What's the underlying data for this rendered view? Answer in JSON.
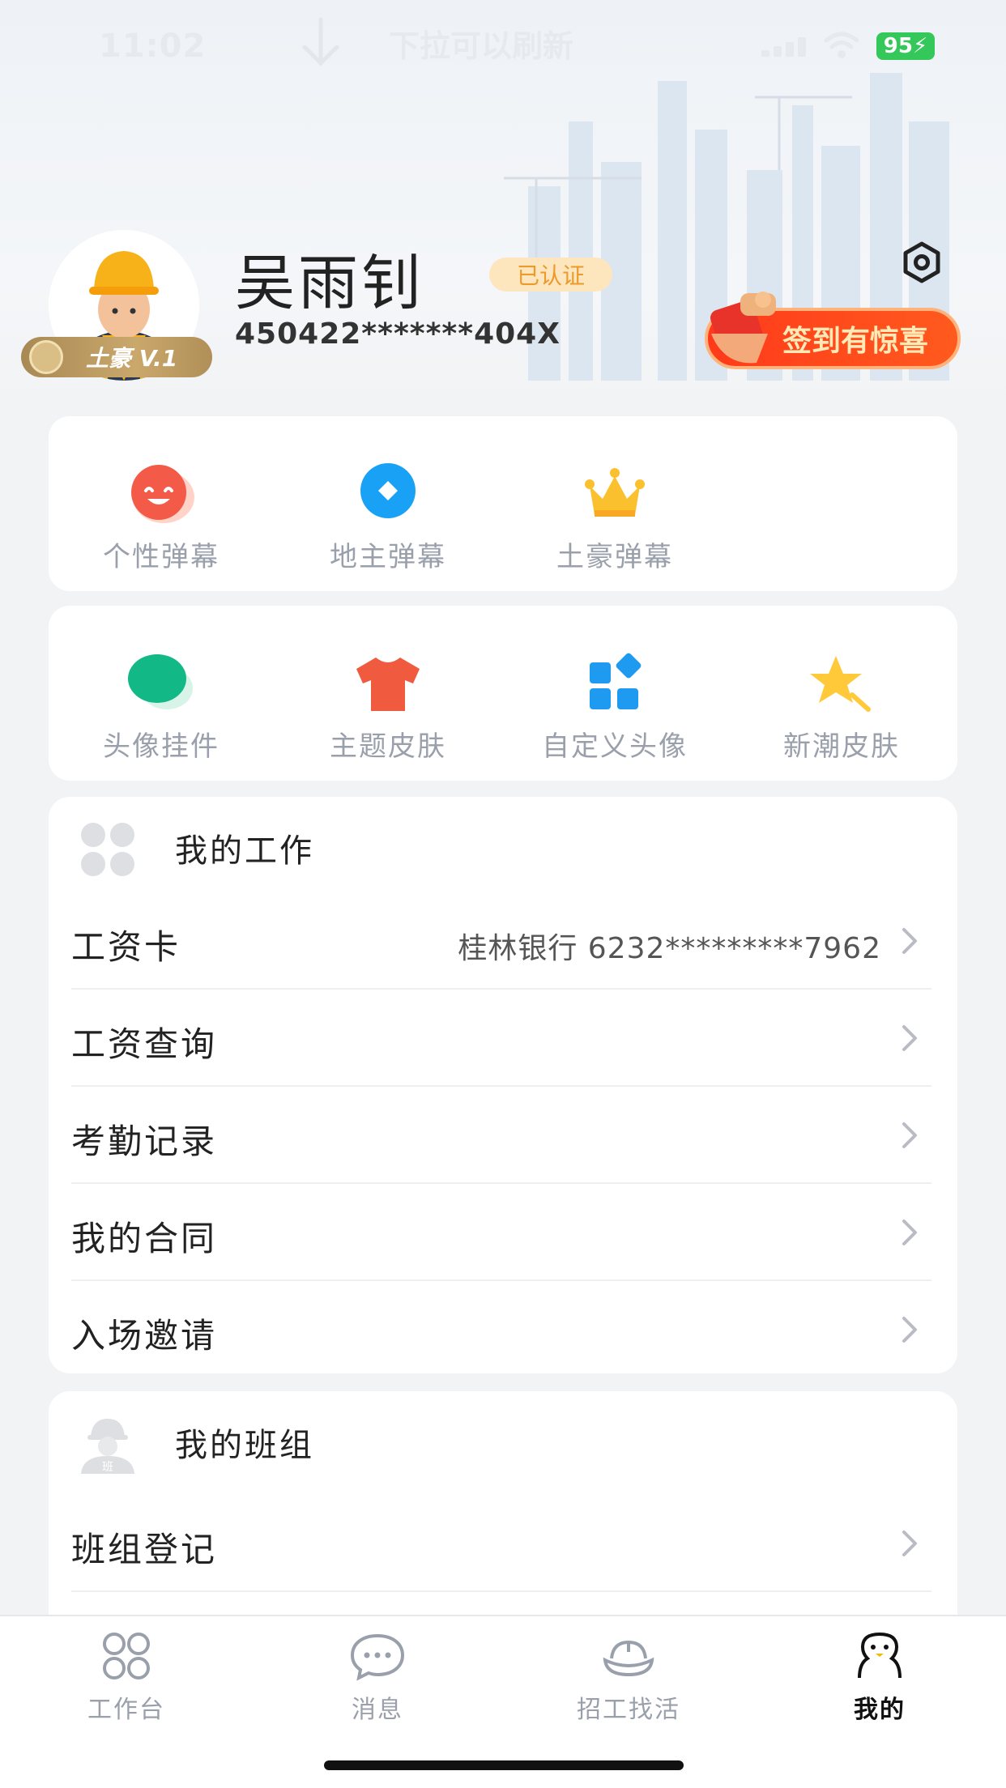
{
  "status_bar": {
    "time": "11:02",
    "pull_hint": "下拉可以刷新",
    "battery": "95"
  },
  "profile": {
    "name": "吴雨钊",
    "verified": "已认证",
    "id_number": "450422*******404X",
    "level": "土豪 V.1",
    "checkin_label": "签到有惊喜"
  },
  "barrage_features": [
    {
      "label": "个性弹幕",
      "icon": "smile-face-icon"
    },
    {
      "label": "地主弹幕",
      "icon": "diamond-icon"
    },
    {
      "label": "土豪弹幕",
      "icon": "crown-icon"
    }
  ],
  "skin_features": [
    {
      "label": "头像挂件",
      "icon": "green-blob-icon"
    },
    {
      "label": "主题皮肤",
      "icon": "tshirt-icon"
    },
    {
      "label": "自定义头像",
      "icon": "grid-blocks-icon"
    },
    {
      "label": "新潮皮肤",
      "icon": "star-wand-icon"
    }
  ],
  "my_work": {
    "title": "我的工作",
    "items": [
      {
        "label": "工资卡",
        "value": "桂林银行 6232*********7962"
      },
      {
        "label": "工资查询",
        "value": ""
      },
      {
        "label": "考勤记录",
        "value": ""
      },
      {
        "label": "我的合同",
        "value": ""
      },
      {
        "label": "入场邀请",
        "value": ""
      }
    ]
  },
  "my_team": {
    "title": "我的班组",
    "items": [
      {
        "label": "班组登记",
        "value": ""
      }
    ]
  },
  "tabbar": [
    {
      "label": "工作台",
      "icon": "workbench-icon",
      "active": false
    },
    {
      "label": "消息",
      "icon": "message-icon",
      "active": false
    },
    {
      "label": "招工找活",
      "icon": "hardhat-icon",
      "active": false
    },
    {
      "label": "我的",
      "icon": "profile-icon",
      "active": true
    }
  ],
  "colors": {
    "accent_red": "#ff3a1a",
    "verified_orange": "#ec9a2a",
    "active_tab": "#111111",
    "inactive_gray": "#9aa0ab"
  }
}
